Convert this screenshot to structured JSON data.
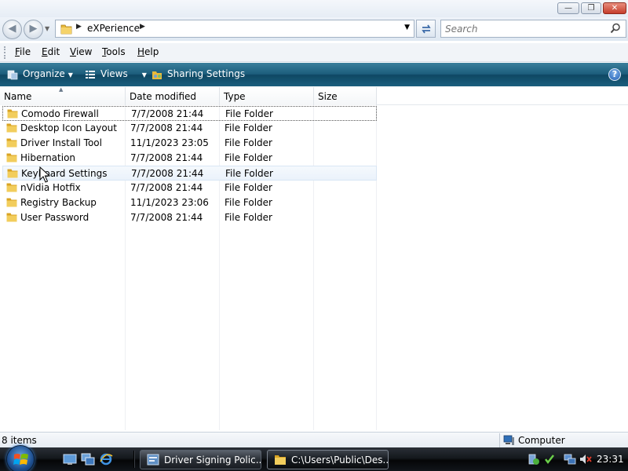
{
  "window": {
    "min_symbol": "—",
    "max_symbol": "❐",
    "close_symbol": "✕"
  },
  "nav": {
    "back_symbol": "◀",
    "forward_symbol": "▶"
  },
  "address": {
    "path_segment": "eXPerience",
    "separator": "▶",
    "dropdown": "▼"
  },
  "search": {
    "placeholder": "Search"
  },
  "menu": {
    "items": [
      {
        "label": "File",
        "key": "F",
        "rest": "ile"
      },
      {
        "label": "Edit",
        "key": "E",
        "rest": "dit"
      },
      {
        "label": "View",
        "key": "V",
        "rest": "iew"
      },
      {
        "label": "Tools",
        "key": "T",
        "rest": "ools"
      },
      {
        "label": "Help",
        "key": "H",
        "rest": "elp"
      }
    ]
  },
  "commandbar": {
    "organize": "Organize",
    "views": "Views",
    "sharing": "Sharing Settings",
    "arrow": "▼",
    "help": "?"
  },
  "columns": {
    "name": "Name",
    "date": "Date modified",
    "type": "Type",
    "size": "Size",
    "sort_arrow": "▲"
  },
  "files": [
    {
      "name": "Comodo Firewall",
      "date": "7/7/2008 21:44",
      "type": "File Folder"
    },
    {
      "name": "Desktop Icon Layout",
      "date": "7/7/2008 21:44",
      "type": "File Folder"
    },
    {
      "name": "Driver Install Tool",
      "date": "11/1/2023 23:05",
      "type": "File Folder"
    },
    {
      "name": "Hibernation",
      "date": "7/7/2008 21:44",
      "type": "File Folder"
    },
    {
      "name": "Keyboard Settings",
      "date": "7/7/2008 21:44",
      "type": "File Folder"
    },
    {
      "name": "nVidia Hotfix",
      "date": "7/7/2008 21:44",
      "type": "File Folder"
    },
    {
      "name": "Registry Backup",
      "date": "11/1/2023 23:06",
      "type": "File Folder"
    },
    {
      "name": "User Password",
      "date": "7/7/2008 21:44",
      "type": "File Folder"
    }
  ],
  "status": {
    "items": "8 items",
    "location": "Computer"
  },
  "taskbar": {
    "task1": "Driver Signing Polic...",
    "task2": "C:\\Users\\Public\\Des...",
    "clock": "23:31"
  },
  "colors": {
    "folder": "#e8b93b",
    "commandbar": "#1c5d7c",
    "hover_row": "#eaf2fb"
  }
}
